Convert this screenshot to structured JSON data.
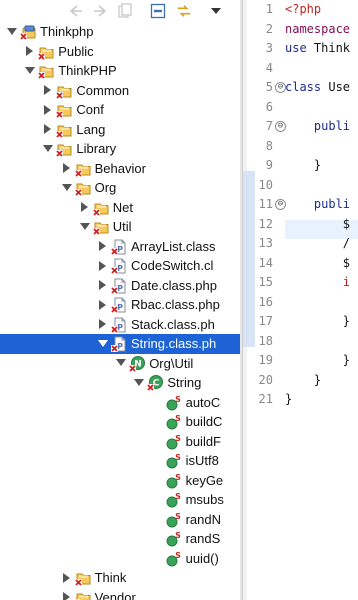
{
  "explorer": {
    "toolbar": {
      "back_icon": "back-arrow-icon",
      "forward_icon": "forward-arrow-icon",
      "home_icon": "home-icon",
      "collapse_all_icon": "collapse-all-icon",
      "link_editor_icon": "link-with-editor-icon",
      "view_menu_icon": "view-menu-icon"
    },
    "tree": [
      {
        "label": "Thinkphp",
        "icon": "php-project-icon",
        "expanded": true
      },
      {
        "label": "Public",
        "icon": "folder-icon",
        "expanded": false
      },
      {
        "label": "ThinkPHP",
        "icon": "folder-icon",
        "expanded": true
      },
      {
        "label": "Common",
        "icon": "package-folder-icon",
        "expanded": false
      },
      {
        "label": "Conf",
        "icon": "package-folder-icon",
        "expanded": false
      },
      {
        "label": "Lang",
        "icon": "package-folder-icon",
        "expanded": false
      },
      {
        "label": "Library",
        "icon": "package-folder-icon",
        "expanded": true
      },
      {
        "label": "Behavior",
        "icon": "package-folder-icon",
        "expanded": false
      },
      {
        "label": "Org",
        "icon": "package-folder-icon",
        "expanded": true
      },
      {
        "label": "Net",
        "icon": "package-folder-icon",
        "expanded": false
      },
      {
        "label": "Util",
        "icon": "package-folder-icon",
        "expanded": true
      },
      {
        "label": "ArrayList.class",
        "icon": "php-file-icon",
        "expanded": false
      },
      {
        "label": "CodeSwitch.cl",
        "icon": "php-file-icon",
        "expanded": false
      },
      {
        "label": "Date.class.php",
        "icon": "php-file-icon",
        "expanded": false
      },
      {
        "label": "Rbac.class.php",
        "icon": "php-file-icon",
        "expanded": false
      },
      {
        "label": "Stack.class.ph",
        "icon": "php-file-icon",
        "expanded": false
      },
      {
        "label": "String.class.ph",
        "icon": "php-file-icon",
        "expanded": true
      },
      {
        "label": "Org\\Util",
        "icon": "namespace-icon",
        "expanded": true
      },
      {
        "label": "String",
        "icon": "class-icon",
        "expanded": true
      },
      {
        "label": "autoC",
        "icon": "static-method-icon"
      },
      {
        "label": "buildC",
        "icon": "static-method-icon"
      },
      {
        "label": "buildF",
        "icon": "static-method-icon"
      },
      {
        "label": "isUtf8",
        "icon": "static-method-icon"
      },
      {
        "label": "keyGe",
        "icon": "static-method-icon"
      },
      {
        "label": "msubs",
        "icon": "static-method-icon"
      },
      {
        "label": "randN",
        "icon": "static-method-icon"
      },
      {
        "label": "randS",
        "icon": "static-method-icon"
      },
      {
        "label": "uuid()",
        "icon": "static-method-icon"
      },
      {
        "label": "Think",
        "icon": "package-folder-icon",
        "expanded": false
      },
      {
        "label": "Vendor",
        "icon": "package-folder-icon",
        "expanded": false
      }
    ]
  },
  "editor": {
    "line_numbers": [
      "1",
      "2",
      "3",
      "4",
      "5",
      "6",
      "7",
      "8",
      "9",
      "10",
      "11",
      "12",
      "13",
      "14",
      "15",
      "16",
      "17",
      "18",
      "19",
      "20",
      "21"
    ],
    "fold_markers": [
      {
        "line": "5",
        "symbol": "⊖"
      },
      {
        "line": "7",
        "symbol": "⊖"
      },
      {
        "line": "11",
        "symbol": "⊖"
      }
    ],
    "lines": [
      {
        "tokens": [
          {
            "t": "<?php",
            "c": "kw-red"
          }
        ]
      },
      {
        "tokens": [
          {
            "t": "namespace",
            "c": "kw-purple"
          }
        ]
      },
      {
        "tokens": [
          {
            "t": "use",
            "c": "kw-navy"
          },
          {
            "t": " Think",
            "c": "plain"
          }
        ]
      },
      {
        "tokens": []
      },
      {
        "tokens": [
          {
            "t": "class",
            "c": "kw-navy"
          },
          {
            "t": " Use",
            "c": "plain"
          }
        ]
      },
      {
        "tokens": []
      },
      {
        "tokens": [
          {
            "t": "    publi",
            "c": "kw-navy"
          }
        ]
      },
      {
        "tokens": []
      },
      {
        "tokens": [
          {
            "t": "    }",
            "c": "plain"
          }
        ]
      },
      {
        "tokens": []
      },
      {
        "tokens": [
          {
            "t": "    publi",
            "c": "kw-navy"
          }
        ]
      },
      {
        "tokens": [
          {
            "t": "        $",
            "c": "plain"
          }
        ]
      },
      {
        "tokens": [
          {
            "t": "        /",
            "c": "plain"
          }
        ]
      },
      {
        "tokens": [
          {
            "t": "        $",
            "c": "plain"
          }
        ]
      },
      {
        "tokens": [
          {
            "t": "        i",
            "c": "kw-red"
          }
        ]
      },
      {
        "tokens": []
      },
      {
        "tokens": [
          {
            "t": "        }",
            "c": "plain"
          }
        ]
      },
      {
        "tokens": []
      },
      {
        "tokens": [
          {
            "t": "        }",
            "c": "plain"
          }
        ]
      },
      {
        "tokens": [
          {
            "t": "    }",
            "c": "plain"
          }
        ]
      },
      {
        "tokens": [
          {
            "t": "}",
            "c": "plain"
          }
        ]
      }
    ]
  }
}
